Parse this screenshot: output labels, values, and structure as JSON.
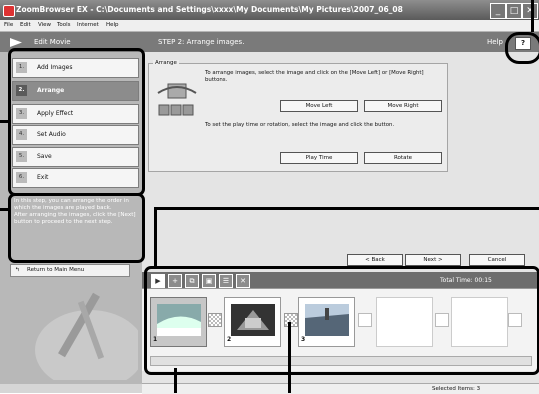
{
  "window": {
    "title": "ZoomBrowser EX  -  C:\\Documents and Settings\\xxxx\\My Documents\\My Pictures\\2007_06_08",
    "minimize_icon": "minimize-icon",
    "maximize_icon": "maximize-icon",
    "close_icon": "close-icon"
  },
  "menu": [
    "File",
    "Edit",
    "View",
    "Tools",
    "Internet",
    "Help"
  ],
  "left_panel": {
    "title": "Edit Movie",
    "steps": [
      {
        "num": "1.",
        "label": "Add Images"
      },
      {
        "num": "2.",
        "label": "Arrange"
      },
      {
        "num": "3.",
        "label": "Apply Effect"
      },
      {
        "num": "4.",
        "label": "Set Audio"
      },
      {
        "num": "5.",
        "label": "Save"
      },
      {
        "num": "6.",
        "label": "Exit"
      }
    ],
    "active_step": 2,
    "help_text": "In this step, you can arrange the order in which the images are played back.\nAfter arranging the images, click the [Next] button to proceed to the next step.",
    "return_button": "Return to Main Menu"
  },
  "main": {
    "step_title": "STEP 2: Arrange images.",
    "help_label": "Help",
    "help_button": "?",
    "arrange_group": "Arrange",
    "instruction_1": "To arrange images, select the image and click on the [Move Left] or [Move Right] buttons.",
    "move_left": "Move Left",
    "move_right": "Move Right",
    "instruction_2": "To set the play time or rotation, select the image and click the button.",
    "play_time": "Play Time",
    "rotate": "Rotate",
    "back": "< Back",
    "next": "Next >",
    "cancel": "Cancel"
  },
  "strip": {
    "total_time_label": "Total Time: 00:15",
    "frames": [
      {
        "num": "1",
        "selected": true
      },
      {
        "num": "2",
        "selected": false
      },
      {
        "num": "3",
        "selected": false
      }
    ],
    "status": "Selected Items: 3"
  },
  "colors": {
    "accent": "#7a7a7a",
    "active_step": "#8c8c8c"
  }
}
